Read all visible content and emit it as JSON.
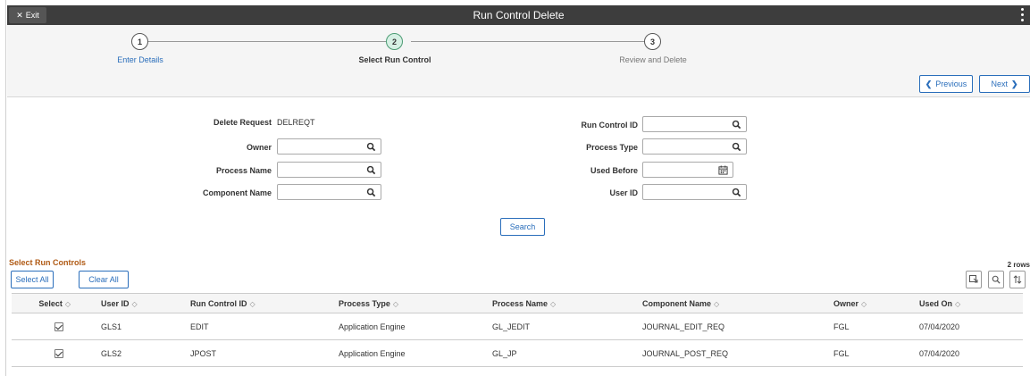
{
  "titlebar": {
    "exit_label": "Exit",
    "title": "Run Control Delete"
  },
  "train": {
    "steps": [
      {
        "number": "1",
        "label": "Enter Details"
      },
      {
        "number": "2",
        "label": "Select Run Control"
      },
      {
        "number": "3",
        "label": "Review and Delete"
      }
    ],
    "previous_label": "Previous",
    "next_label": "Next"
  },
  "form": {
    "delete_request": {
      "label": "Delete Request",
      "value": "DELREQT"
    },
    "owner": {
      "label": "Owner",
      "value": ""
    },
    "process_name": {
      "label": "Process Name",
      "value": ""
    },
    "component_name": {
      "label": "Component Name",
      "value": ""
    },
    "run_control_id": {
      "label": "Run Control ID",
      "value": ""
    },
    "process_type": {
      "label": "Process Type",
      "value": ""
    },
    "used_before": {
      "label": "Used Before",
      "value": ""
    },
    "user_id": {
      "label": "User ID",
      "value": ""
    },
    "search_label": "Search"
  },
  "grid": {
    "title": "Select Run Controls",
    "row_count": "2 rows",
    "select_all_label": "Select All",
    "clear_all_label": "Clear All",
    "columns": [
      "Select",
      "User ID",
      "Run Control ID",
      "Process Type",
      "Process Name",
      "Component Name",
      "Owner",
      "Used On"
    ],
    "rows": [
      {
        "selected": true,
        "user_id": "GLS1",
        "run_control_id": "EDIT",
        "process_type": "Application Engine",
        "process_name": "GL_JEDIT",
        "component_name": "JOURNAL_EDIT_REQ",
        "owner": "FGL",
        "used_on": "07/04/2020"
      },
      {
        "selected": true,
        "user_id": "GLS2",
        "run_control_id": "JPOST",
        "process_type": "Application Engine",
        "process_name": "GL_JP",
        "component_name": "JOURNAL_POST_REQ",
        "owner": "FGL",
        "used_on": "07/04/2020"
      }
    ]
  },
  "colors": {
    "titlebar": "#3d3d3d",
    "link": "#2a6ebb",
    "grid_title": "#b05a14",
    "active_step": "#d6f0e4"
  }
}
